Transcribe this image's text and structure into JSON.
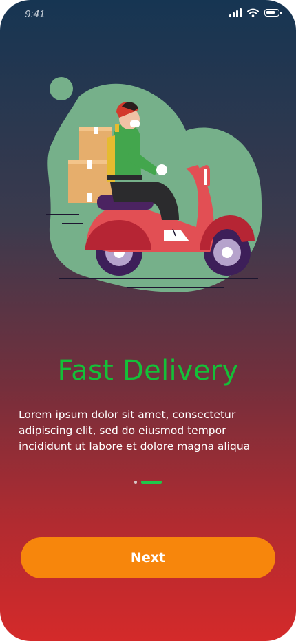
{
  "status_bar": {
    "time": "9:41",
    "icons": [
      "cellular-signal-icon",
      "wifi-icon",
      "battery-icon"
    ]
  },
  "onboarding": {
    "illustration": "delivery-scooter-illustration",
    "title": "Fast Delivery",
    "description": "Lorem ipsum dolor sit amet, consectetur adipiscing elit, sed do eiusmod tempor incididunt ut labore et dolore magna aliqua",
    "page_indicator": {
      "total": 2,
      "current": 2
    }
  },
  "actions": {
    "next_label": "Next"
  },
  "colors": {
    "title": "#14c038",
    "button": "#f7860c",
    "active_dot": "#1ec84a",
    "gradient_top": "#163552",
    "gradient_bottom": "#d42a2a"
  }
}
